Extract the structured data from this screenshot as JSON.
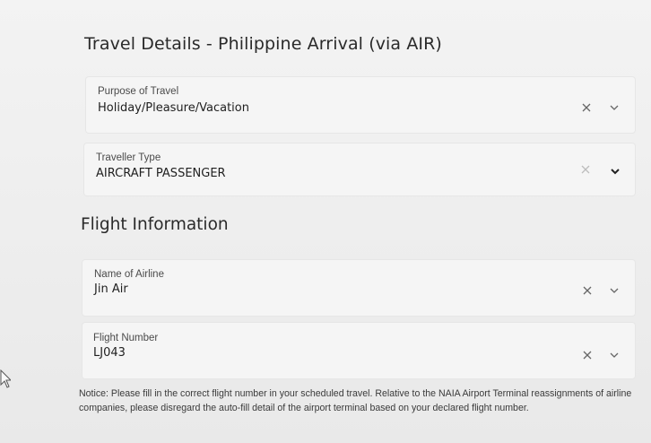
{
  "travel_details": {
    "title": "Travel Details - Philippine Arrival (via AIR)",
    "purpose": {
      "label": "Purpose of Travel",
      "value": "Holiday/Pleasure/Vacation"
    },
    "traveller_type": {
      "label": "Traveller Type",
      "value": "AIRCRAFT PASSENGER"
    }
  },
  "flight_info": {
    "title": "Flight Information",
    "airline": {
      "label": "Name of Airline",
      "value": "Jin Air"
    },
    "flight_number": {
      "label": "Flight Number",
      "value": "LJ043"
    }
  },
  "notice": "Notice: Please fill in the correct flight number in your scheduled travel. Relative to the NAIA Airport Terminal reassignments of airline companies, please disregard the auto-fill detail of the airport terminal based on your declared flight number.",
  "icons": {
    "clear": "close-icon",
    "dropdown": "chevron-down-icon",
    "cursor": "mouse-pointer-icon"
  },
  "colors": {
    "page_bg": "#efefef",
    "field_bg": "#f5f5f5",
    "text": "#1f1f1f",
    "muted_icon": "#6d6d6d"
  }
}
